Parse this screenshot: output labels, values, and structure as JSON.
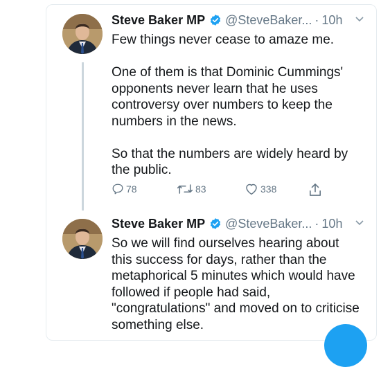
{
  "tweets": [
    {
      "author": "Steve Baker MP",
      "handle": "@SteveBaker...",
      "separator": "·",
      "time": "10h",
      "paragraphs": [
        "Few things never cease to amaze me.",
        "One of them is that Dominic Cummings' opponents never learn that he uses controversy over numbers to keep the numbers in the news.",
        "So that the numbers are widely heard by the public."
      ],
      "replies": "78",
      "retweets": "83",
      "likes": "338"
    },
    {
      "author": "Steve Baker MP",
      "handle": "@SteveBaker...",
      "separator": "·",
      "time": "10h",
      "paragraphs": [
        "So we will find ourselves hearing about this success for days, rather than the metaphorical 5 minutes which would have followed if people had said, \"congratulations\" and moved on to criticise something else."
      ]
    }
  ],
  "icons": {
    "verified": "verified-badge-icon",
    "reply": "reply-icon",
    "retweet": "retweet-icon",
    "like": "heart-icon",
    "share": "share-icon",
    "menu": "chevron-down-icon",
    "compose": "compose-fab"
  },
  "colors": {
    "accent": "#1da1f2",
    "secondary_text": "#657786",
    "primary_text": "#14171a"
  }
}
